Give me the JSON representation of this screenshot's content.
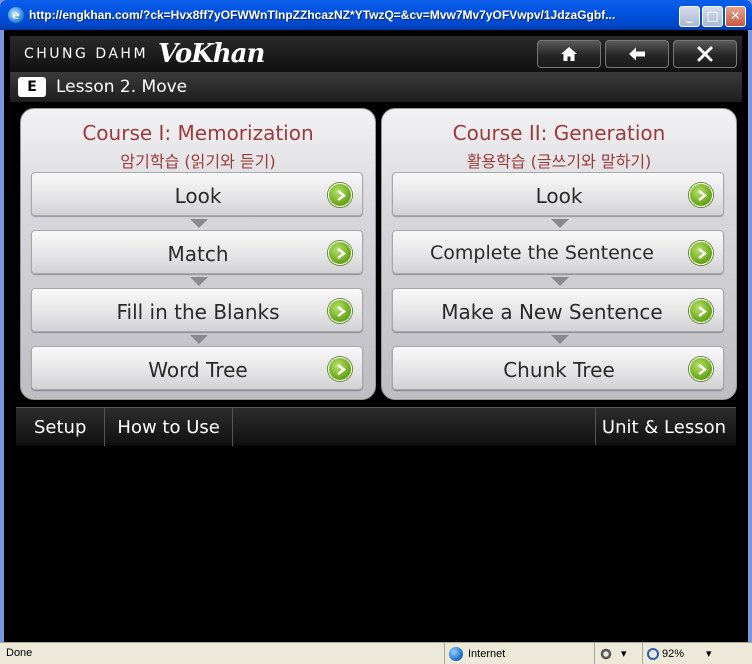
{
  "window": {
    "title": "http://engkhan.com/?ck=Hvx8ff7yOFWWnTInpZZhcazNZ*YTwzQ=&cv=Mvw7Mv7yOFVwpv/1JdzaGgbf...",
    "min_glyph": "_",
    "max_glyph": "□",
    "close_glyph": "✕"
  },
  "header": {
    "brand": "CHUNG DAHM",
    "logo": "VoKhan"
  },
  "lesson": {
    "badge": "E",
    "title": "Lesson 2. Move"
  },
  "courses": [
    {
      "title": "Course I: Memorization",
      "subtitle": "암기학습 (읽기와 듣기)",
      "steps": [
        "Look",
        "Match",
        "Fill in the Blanks",
        "Word Tree"
      ]
    },
    {
      "title": "Course II: Generation",
      "subtitle": "활용학습 (글쓰기와 말하기)",
      "steps": [
        "Look",
        "Complete the Sentence",
        "Make a New Sentence",
        "Chunk Tree"
      ]
    }
  ],
  "menu": {
    "setup": "Setup",
    "how_to_use": "How to Use",
    "unit_lesson": "Unit & Lesson"
  },
  "status": {
    "done": "Done",
    "zone": "Internet",
    "zoom": "92%"
  },
  "colors": {
    "course_title": "#9b3b3b",
    "go_button": "#6fac1f"
  }
}
